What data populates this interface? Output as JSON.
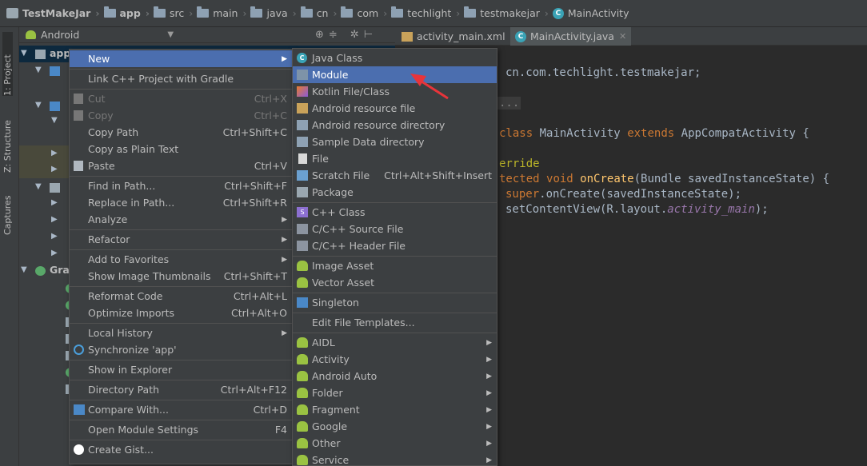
{
  "breadcrumb": [
    {
      "label": "TestMakeJar",
      "icon": "project-icon"
    },
    {
      "label": "app",
      "icon": "module-folder-icon"
    },
    {
      "label": "src",
      "icon": "folder-icon"
    },
    {
      "label": "main",
      "icon": "folder-icon"
    },
    {
      "label": "java",
      "icon": "source-folder-icon"
    },
    {
      "label": "cn",
      "icon": "package-icon"
    },
    {
      "label": "com",
      "icon": "package-icon"
    },
    {
      "label": "techlight",
      "icon": "package-icon"
    },
    {
      "label": "testmakejar",
      "icon": "package-icon"
    },
    {
      "label": "MainActivity",
      "icon": "class-icon"
    }
  ],
  "side_tabs": {
    "project": "1: Project",
    "structure": "Z: Structure",
    "captures": "Captures"
  },
  "project_panel": {
    "view_mode": "Android",
    "root_item": "app",
    "gradle_item": "Gra"
  },
  "editor": {
    "tabs": [
      {
        "label": "activity_main.xml",
        "active": false
      },
      {
        "label": "MainActivity.java",
        "active": true
      }
    ],
    "code_lines": {
      "package_rest": "cn.com.techlight.testmakejar;",
      "import_fold": "...",
      "kw_class": "class",
      "class_name": "MainActivity",
      "kw_extends": "extends",
      "super_class": "AppCompatActivity {",
      "annotation": "erride",
      "kw_protected": "tected",
      "kw_void": "void",
      "method": "onCreate",
      "params": "(Bundle savedInstanceState) {",
      "kw_super": "super",
      "super_call": ".onCreate(savedInstanceState);",
      "set_content": "setContentView(R.layout.",
      "layout_field": "activity_main",
      "set_content_end": ");"
    }
  },
  "context_menu": {
    "items": [
      {
        "label": "New",
        "shortcut": "",
        "submenu": true,
        "selected": true,
        "disabled": false,
        "icon": ""
      },
      {
        "separator": true
      },
      {
        "label": "Link C++ Project with Gradle",
        "shortcut": "",
        "submenu": false,
        "disabled": false,
        "icon": ""
      },
      {
        "separator": true
      },
      {
        "label": "Cut",
        "shortcut": "Ctrl+X",
        "submenu": false,
        "disabled": true,
        "icon": "scissors-icon"
      },
      {
        "label": "Copy",
        "shortcut": "Ctrl+C",
        "submenu": false,
        "disabled": true,
        "icon": "copy-icon"
      },
      {
        "label": "Copy Path",
        "shortcut": "Ctrl+Shift+C",
        "submenu": false,
        "disabled": false,
        "icon": ""
      },
      {
        "label": "Copy as Plain Text",
        "shortcut": "",
        "submenu": false,
        "disabled": false,
        "icon": ""
      },
      {
        "label": "Paste",
        "shortcut": "Ctrl+V",
        "submenu": false,
        "disabled": false,
        "icon": "paste-icon"
      },
      {
        "separator": true
      },
      {
        "label": "Find in Path...",
        "shortcut": "Ctrl+Shift+F",
        "submenu": false,
        "disabled": false,
        "icon": ""
      },
      {
        "label": "Replace in Path...",
        "shortcut": "Ctrl+Shift+R",
        "submenu": false,
        "disabled": false,
        "icon": ""
      },
      {
        "label": "Analyze",
        "shortcut": "",
        "submenu": true,
        "disabled": false,
        "icon": ""
      },
      {
        "separator": true
      },
      {
        "label": "Refactor",
        "shortcut": "",
        "submenu": true,
        "disabled": false,
        "icon": ""
      },
      {
        "separator": true
      },
      {
        "label": "Add to Favorites",
        "shortcut": "",
        "submenu": true,
        "disabled": false,
        "icon": ""
      },
      {
        "label": "Show Image Thumbnails",
        "shortcut": "Ctrl+Shift+T",
        "submenu": false,
        "disabled": false,
        "icon": ""
      },
      {
        "separator": true
      },
      {
        "label": "Reformat Code",
        "shortcut": "Ctrl+Alt+L",
        "submenu": false,
        "disabled": false,
        "icon": ""
      },
      {
        "label": "Optimize Imports",
        "shortcut": "Ctrl+Alt+O",
        "submenu": false,
        "disabled": false,
        "icon": ""
      },
      {
        "separator": true
      },
      {
        "label": "Local History",
        "shortcut": "",
        "submenu": true,
        "disabled": false,
        "icon": ""
      },
      {
        "label": "Synchronize 'app'",
        "shortcut": "",
        "submenu": false,
        "disabled": false,
        "icon": "sync-icon"
      },
      {
        "separator": true
      },
      {
        "label": "Show in Explorer",
        "shortcut": "",
        "submenu": false,
        "disabled": false,
        "icon": ""
      },
      {
        "separator": true
      },
      {
        "label": "Directory Path",
        "shortcut": "Ctrl+Alt+F12",
        "submenu": false,
        "disabled": false,
        "icon": ""
      },
      {
        "separator": true
      },
      {
        "label": "Compare With...",
        "shortcut": "Ctrl+D",
        "submenu": false,
        "disabled": false,
        "icon": "compare-icon"
      },
      {
        "separator": true
      },
      {
        "label": "Open Module Settings",
        "shortcut": "F4",
        "submenu": false,
        "disabled": false,
        "icon": ""
      },
      {
        "separator": true
      },
      {
        "label": "Create Gist...",
        "shortcut": "",
        "submenu": false,
        "disabled": false,
        "icon": "github-icon"
      }
    ]
  },
  "new_submenu": {
    "items": [
      {
        "label": "Java Class",
        "shortcut": "",
        "submenu": false,
        "icon": "java-class-icon"
      },
      {
        "label": "Module",
        "shortcut": "",
        "submenu": false,
        "selected": true,
        "icon": "module-icon"
      },
      {
        "label": "Kotlin File/Class",
        "shortcut": "",
        "submenu": false,
        "icon": "kotlin-icon"
      },
      {
        "label": "Android resource file",
        "shortcut": "",
        "submenu": false,
        "icon": "resource-file-icon"
      },
      {
        "label": "Android resource directory",
        "shortcut": "",
        "submenu": false,
        "icon": "folder-icon"
      },
      {
        "label": "Sample Data directory",
        "shortcut": "",
        "submenu": false,
        "icon": "folder-icon"
      },
      {
        "label": "File",
        "shortcut": "",
        "submenu": false,
        "icon": "file-icon"
      },
      {
        "label": "Scratch File",
        "shortcut": "Ctrl+Alt+Shift+Insert",
        "submenu": false,
        "icon": "scratch-file-icon"
      },
      {
        "label": "Package",
        "shortcut": "",
        "submenu": false,
        "icon": "package-icon"
      },
      {
        "separator": true
      },
      {
        "label": "C++ Class",
        "shortcut": "",
        "submenu": false,
        "icon": "cpp-class-icon"
      },
      {
        "label": "C/C++ Source File",
        "shortcut": "",
        "submenu": false,
        "icon": "cpp-source-icon"
      },
      {
        "label": "C/C++ Header File",
        "shortcut": "",
        "submenu": false,
        "icon": "cpp-header-icon"
      },
      {
        "separator": true
      },
      {
        "label": "Image Asset",
        "shortcut": "",
        "submenu": false,
        "icon": "android-icon"
      },
      {
        "label": "Vector Asset",
        "shortcut": "",
        "submenu": false,
        "icon": "android-icon"
      },
      {
        "separator": true
      },
      {
        "label": "Singleton",
        "shortcut": "",
        "submenu": false,
        "icon": "singleton-icon"
      },
      {
        "separator": true
      },
      {
        "label": "Edit File Templates...",
        "shortcut": "",
        "submenu": false,
        "icon": ""
      },
      {
        "separator": true
      },
      {
        "label": "AIDL",
        "shortcut": "",
        "submenu": true,
        "icon": "android-icon"
      },
      {
        "label": "Activity",
        "shortcut": "",
        "submenu": true,
        "icon": "android-icon"
      },
      {
        "label": "Android Auto",
        "shortcut": "",
        "submenu": true,
        "icon": "android-icon"
      },
      {
        "label": "Folder",
        "shortcut": "",
        "submenu": true,
        "icon": "android-icon"
      },
      {
        "label": "Fragment",
        "shortcut": "",
        "submenu": true,
        "icon": "android-icon"
      },
      {
        "label": "Google",
        "shortcut": "",
        "submenu": true,
        "icon": "android-icon"
      },
      {
        "label": "Other",
        "shortcut": "",
        "submenu": true,
        "icon": "android-icon"
      },
      {
        "label": "Service",
        "shortcut": "",
        "submenu": true,
        "icon": "android-icon"
      }
    ]
  },
  "colors": {
    "selection": "#4b6eaf",
    "annotation_arrow": "#e8343a"
  }
}
